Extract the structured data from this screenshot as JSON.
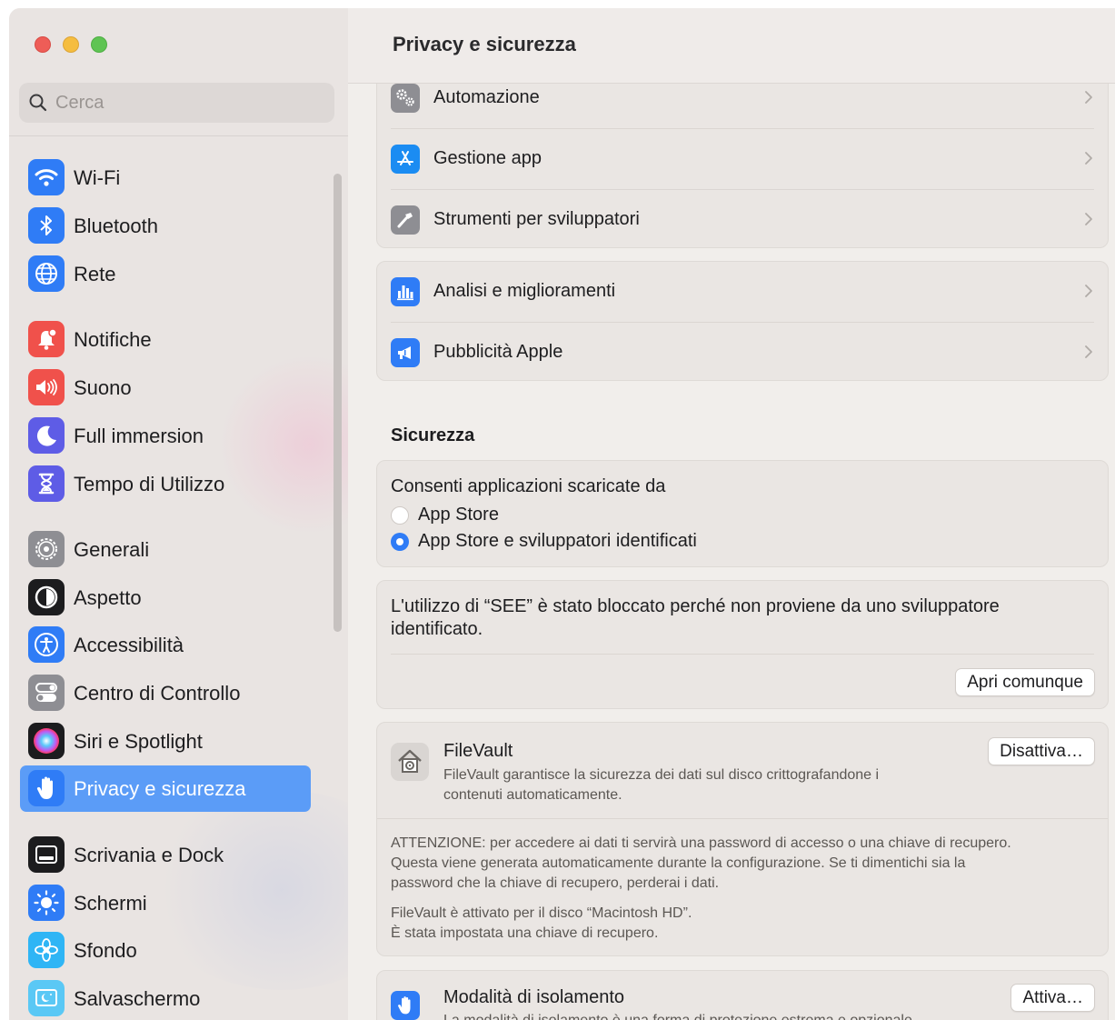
{
  "window": {
    "sidebar": {
      "search": {
        "placeholder": "Cerca"
      },
      "items": [
        {
          "label": "Wi-Fi",
          "icon": "wifi-icon",
          "color": "#2f7cf6"
        },
        {
          "label": "Bluetooth",
          "icon": "bluetooth-icon",
          "color": "#2f7cf6"
        },
        {
          "label": "Rete",
          "icon": "globe-icon",
          "color": "#2f7cf6"
        },
        {
          "label": "Notifiche",
          "icon": "bell-icon",
          "color": "#f0514b"
        },
        {
          "label": "Suono",
          "icon": "speaker-icon",
          "color": "#f0514b"
        },
        {
          "label": "Full immersion",
          "icon": "moon-icon",
          "color": "#5e5ce6"
        },
        {
          "label": "Tempo di Utilizzo",
          "icon": "hourglass-icon",
          "color": "#5e5ce6"
        },
        {
          "label": "Generali",
          "icon": "gear-icon",
          "color": "#8e8e93"
        },
        {
          "label": "Aspetto",
          "icon": "appearance-icon",
          "color": "#1c1c1e"
        },
        {
          "label": "Accessibilità",
          "icon": "accessibility-icon",
          "color": "#2f7cf6"
        },
        {
          "label": "Centro di Controllo",
          "icon": "toggles-icon",
          "color": "#8e8e93"
        },
        {
          "label": "Siri e Spotlight",
          "icon": "siri-icon",
          "color": "#1c1c1e"
        },
        {
          "label": "Privacy e sicurezza",
          "icon": "hand-icon",
          "color": "#2f7cf6",
          "active": true
        },
        {
          "label": "Scrivania e Dock",
          "icon": "dock-icon",
          "color": "#1c1c1e"
        },
        {
          "label": "Schermi",
          "icon": "sun-icon",
          "color": "#2f7cf6"
        },
        {
          "label": "Sfondo",
          "icon": "flower-icon",
          "color": "#2fb5f5"
        },
        {
          "label": "Salvaschermo",
          "icon": "screensaver-icon",
          "color": "#5ac8f5"
        }
      ]
    },
    "main": {
      "title": "Privacy e sicurezza",
      "group1": [
        {
          "label": "Automazione",
          "icon": "gears-icon"
        },
        {
          "label": "Gestione app",
          "icon": "appstore-icon"
        },
        {
          "label": "Strumenti per sviluppatori",
          "icon": "hammer-icon"
        }
      ],
      "group2": [
        {
          "label": "Analisi e miglioramenti",
          "icon": "chart-icon"
        },
        {
          "label": "Pubblicità Apple",
          "icon": "megaphone-icon"
        }
      ],
      "security": {
        "title": "Sicurezza",
        "allow_label": "Consenti applicazioni scaricate da",
        "options": [
          {
            "label": "App Store",
            "selected": false
          },
          {
            "label": "App Store e sviluppatori identificati",
            "selected": true
          }
        ],
        "blocked_line1": "L'utilizzo di “SEE” è stato bloccato perché non proviene da uno sviluppatore",
        "blocked_line2": "identificato.",
        "open_anyway": "Apri comunque"
      },
      "filevault": {
        "title": "FileVault",
        "desc_line1": "FileVault garantisce la sicurezza dei dati sul disco crittografandone i",
        "desc_line2": "contenuti automaticamente.",
        "button": "Disattiva…",
        "warning_line1": "ATTENZIONE: per accedere ai dati ti servirà una password di accesso o una chiave di recupero.",
        "warning_line2": "Questa viene generata automaticamente durante la configurazione. Se ti dimentichi sia la",
        "warning_line3": "password che la chiave di recupero, perderai i dati.",
        "status_line1": "FileVault è attivato per il disco “Macintosh HD”.",
        "status_line2": "È stata impostata una chiave di recupero."
      },
      "lockdown": {
        "title": "Modalità di isolamento",
        "desc": "La modalità di isolamento è una forma di protezione estrema e opzionale",
        "button": "Attiva…"
      }
    }
  }
}
